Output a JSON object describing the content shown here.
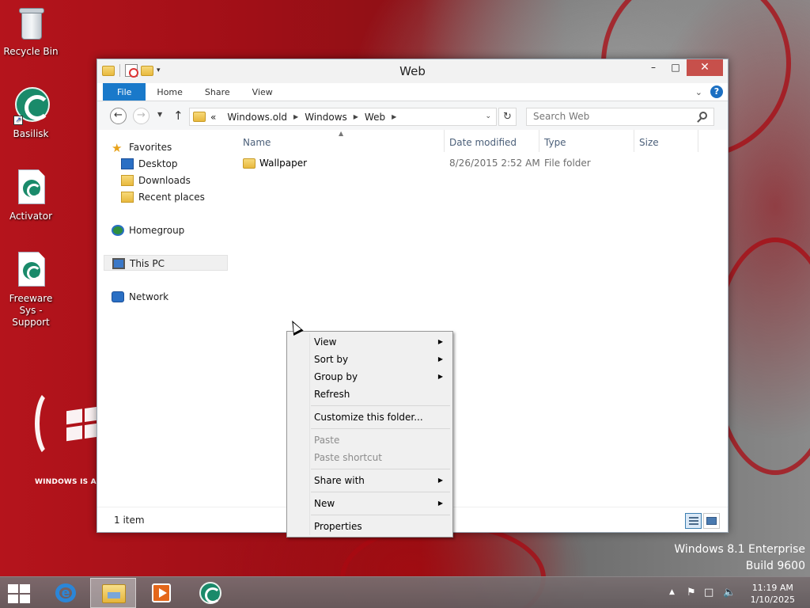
{
  "desktop": {
    "icons": [
      {
        "label": "Recycle Bin",
        "icon": "recycle-bin-icon"
      },
      {
        "label": "Basilisk",
        "icon": "basilisk-icon"
      },
      {
        "label": "Activator",
        "icon": "activator-icon"
      },
      {
        "label": "Freeware Sys - Support",
        "icon": "freeware-support-icon"
      }
    ],
    "brand_text": "WINDOWS IS A PROUD",
    "watermark": {
      "line1": "Windows 8.1 Enterprise",
      "line2": "Build 9600"
    }
  },
  "window": {
    "title": "Web",
    "controls": {
      "minimize": "–",
      "maximize": "□",
      "close": "✕"
    },
    "ribbon": {
      "tabs": [
        "File",
        "Home",
        "Share",
        "View"
      ]
    },
    "nav": {
      "back": "←",
      "forward": "→",
      "up": "↑",
      "refresh": "↻",
      "breadcrumb": [
        "«",
        "Windows.old",
        "Windows",
        "Web"
      ],
      "search_placeholder": "Search Web"
    },
    "navpane": {
      "favorites": "Favorites",
      "desktop": "Desktop",
      "downloads": "Downloads",
      "recent": "Recent places",
      "homegroup": "Homegroup",
      "thispc": "This PC",
      "network": "Network"
    },
    "columns": [
      "Name",
      "Date modified",
      "Type",
      "Size"
    ],
    "files": [
      {
        "name": "Wallpaper",
        "date": "8/26/2015 2:52 AM",
        "type": "File folder",
        "size": ""
      }
    ],
    "status": "1 item"
  },
  "context_menu": {
    "items": [
      {
        "label": "View",
        "submenu": true,
        "enabled": true
      },
      {
        "label": "Sort by",
        "submenu": true,
        "enabled": true
      },
      {
        "label": "Group by",
        "submenu": true,
        "enabled": true
      },
      {
        "label": "Refresh",
        "submenu": false,
        "enabled": true
      },
      {
        "label": "Customize this folder...",
        "submenu": false,
        "enabled": true
      },
      {
        "label": "Paste",
        "submenu": false,
        "enabled": false
      },
      {
        "label": "Paste shortcut",
        "submenu": false,
        "enabled": false
      },
      {
        "label": "Share with",
        "submenu": true,
        "enabled": true
      },
      {
        "label": "New",
        "submenu": true,
        "enabled": true
      },
      {
        "label": "Properties",
        "submenu": false,
        "enabled": true
      }
    ]
  },
  "taskbar": {
    "apps": [
      "internet-explorer-icon",
      "file-explorer-icon",
      "media-player-icon",
      "basilisk-icon"
    ],
    "clock": {
      "time": "11:19 AM",
      "date": "1/10/2025"
    }
  },
  "colors": {
    "accent": "#1979ca",
    "close": "#c7504b",
    "wallpaper": "#a10f17"
  }
}
